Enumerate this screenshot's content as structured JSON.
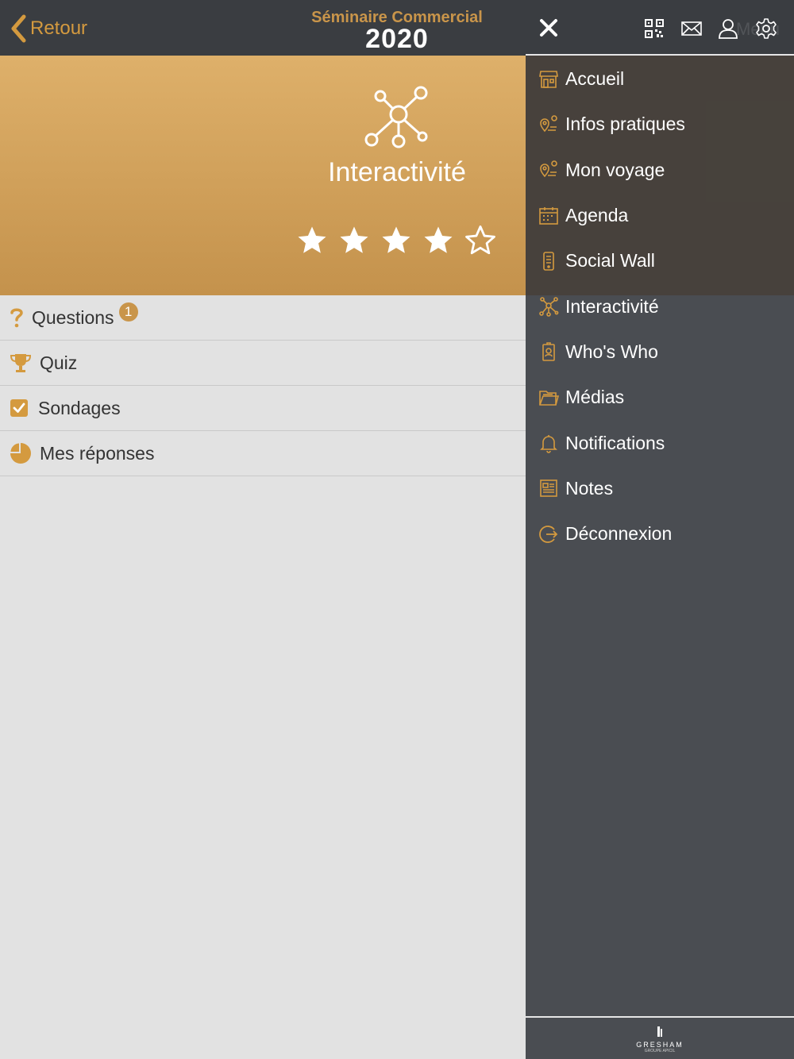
{
  "header": {
    "back_label": "Retour",
    "brand_line1": "Séminaire Commercial",
    "brand_line2": "2020"
  },
  "hero": {
    "title": "Interactivité",
    "rating": 4,
    "rating_max": 5
  },
  "list": [
    {
      "label": "Questions",
      "badge": "1",
      "icon": "question-icon"
    },
    {
      "label": "Quiz",
      "icon": "trophy-icon"
    },
    {
      "label": "Sondages",
      "icon": "checkbox-icon"
    },
    {
      "label": "Mes réponses",
      "icon": "pie-chart-icon"
    }
  ],
  "drawer": {
    "faint_label": "Menu",
    "top_icons": [
      "close-icon",
      "qr-code-icon",
      "envelope-icon",
      "user-icon",
      "gear-icon"
    ],
    "items": [
      {
        "label": "Accueil",
        "icon": "store-icon"
      },
      {
        "label": "Infos pratiques",
        "icon": "map-pin-icon"
      },
      {
        "label": "Mon voyage",
        "icon": "map-pin-icon"
      },
      {
        "label": "Agenda",
        "icon": "calendar-icon"
      },
      {
        "label": "Social Wall",
        "icon": "phone-icon"
      },
      {
        "label": "Interactivité",
        "icon": "network-icon"
      },
      {
        "label": "Who's Who",
        "icon": "badge-icon"
      },
      {
        "label": "Médias",
        "icon": "folder-icon"
      },
      {
        "label": "Notifications",
        "icon": "bell-icon"
      },
      {
        "label": "Notes",
        "icon": "notes-icon"
      },
      {
        "label": "Déconnexion",
        "icon": "logout-icon"
      }
    ],
    "footer": {
      "logo_text": "GRESHAM",
      "logo_sub": "GROUPE APICIL"
    }
  },
  "colors": {
    "accent": "#c9954a",
    "topbar": "#3a3d41",
    "drawer": "#4a4d52",
    "content_bg": "#e2e2e2"
  }
}
